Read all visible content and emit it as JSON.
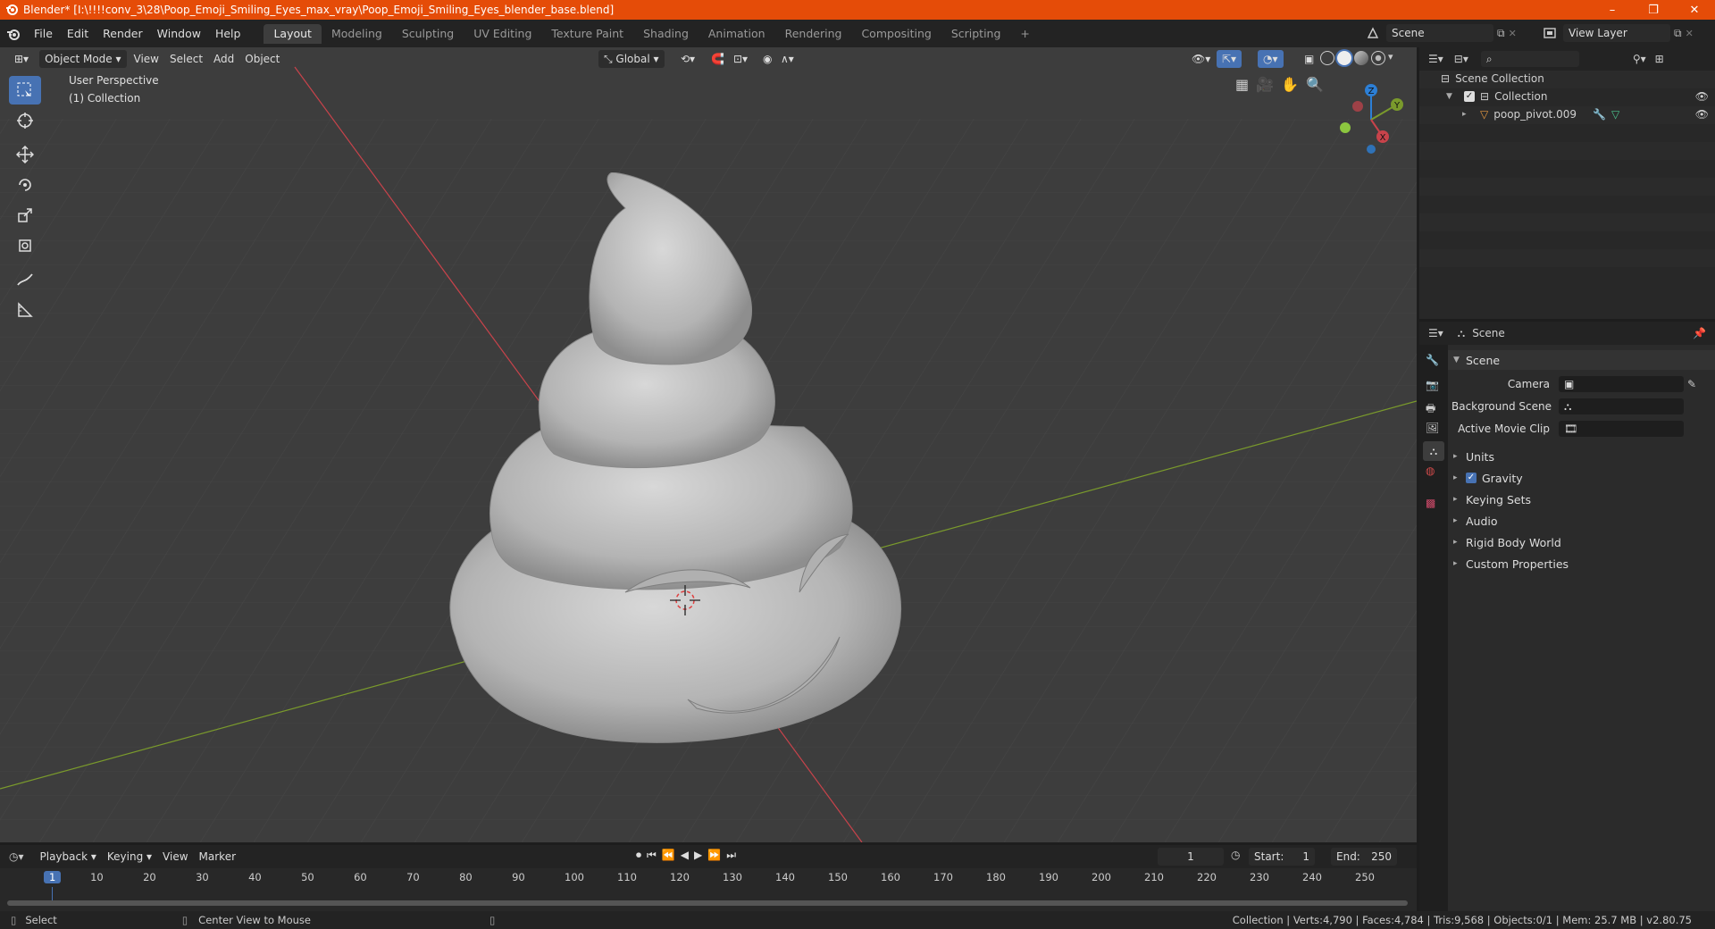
{
  "titlebar": {
    "title": "Blender* [I:\\!!!!conv_3\\28\\Poop_Emoji_Smiling_Eyes_max_vray\\Poop_Emoji_Smiling_Eyes_blender_base.blend]",
    "minimize": "–",
    "maximize": "❐",
    "close": "✕"
  },
  "menu": {
    "items": [
      "File",
      "Edit",
      "Render",
      "Window",
      "Help"
    ]
  },
  "workspaces": {
    "tabs": [
      "Layout",
      "Modeling",
      "Sculpting",
      "UV Editing",
      "Texture Paint",
      "Shading",
      "Animation",
      "Rendering",
      "Compositing",
      "Scripting"
    ],
    "active": "Layout",
    "add": "+"
  },
  "scene_selector": {
    "value": "Scene"
  },
  "viewlayer_selector": {
    "value": "View Layer"
  },
  "viewport": {
    "mode": "Object Mode",
    "menus": [
      "View",
      "Select",
      "Add",
      "Object"
    ],
    "orientation": "Global",
    "overlay_title": "User Perspective",
    "overlay_collection": "(1) Collection",
    "gizmo": {
      "x": "X",
      "y": "Y",
      "z": "Z"
    }
  },
  "outliner": {
    "root": "Scene Collection",
    "collection": "Collection",
    "object": "poop_pivot.009"
  },
  "properties": {
    "header": "Scene",
    "panel": "Scene",
    "fields": {
      "camera": "Camera",
      "background_scene": "Background Scene",
      "active_movie_clip": "Active Movie Clip"
    },
    "subpanels": [
      "Units",
      "Gravity",
      "Keying Sets",
      "Audio",
      "Rigid Body World",
      "Custom Properties"
    ],
    "gravity_checked": true
  },
  "timeline": {
    "menus": [
      "Playback",
      "Keying",
      "View",
      "Marker"
    ],
    "current_frame": "1",
    "start_label": "Start:",
    "start": "1",
    "end_label": "End:",
    "end": "250",
    "ticks": [
      "1",
      "10",
      "20",
      "30",
      "40",
      "50",
      "60",
      "70",
      "80",
      "90",
      "100",
      "110",
      "120",
      "130",
      "140",
      "150",
      "160",
      "170",
      "180",
      "190",
      "200",
      "210",
      "220",
      "230",
      "240",
      "250"
    ]
  },
  "statusbar": {
    "left": "Select",
    "middle": "Center View to Mouse",
    "stats": "Collection | Verts:4,790 | Faces:4,784 | Tris:9,568 | Objects:0/1 | Mem: 25.7 MB | v2.80.75"
  },
  "colors": {
    "accent": "#4772b3",
    "titlebar": "#e54c08",
    "x_axis": "#c8434b",
    "y_axis": "#7a9a2c"
  }
}
